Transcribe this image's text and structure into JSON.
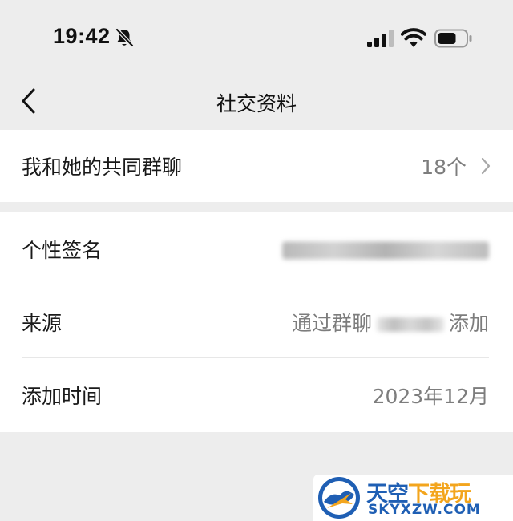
{
  "status_bar": {
    "time": "19:42",
    "icons": [
      "bell-slash-icon",
      "signal-icon",
      "wifi-icon",
      "battery-icon"
    ]
  },
  "nav": {
    "back_icon": "chevron-left-icon",
    "title": "社交资料"
  },
  "group_chats": {
    "label": "我和她的共同群聊",
    "count": "18个"
  },
  "profile_rows": {
    "signature": {
      "label": "个性签名",
      "value": ""
    },
    "source": {
      "label": "来源",
      "value_prefix": "通过群聊",
      "value_suffix": "添加"
    },
    "added_time": {
      "label": "添加时间",
      "value": "2023年12月"
    }
  },
  "watermark": {
    "title_main": "天空",
    "title_accent": "下载玩",
    "domain": "SKYXZW.COM"
  },
  "colors": {
    "page_background": "#ededed",
    "card_background": "#ffffff",
    "primary_text": "#1a1a1a",
    "secondary_text": "#7d7d7d",
    "divider": "#e7e7e7",
    "watermark_blue": "#1f5fb4",
    "watermark_orange": "#f3a51d"
  }
}
